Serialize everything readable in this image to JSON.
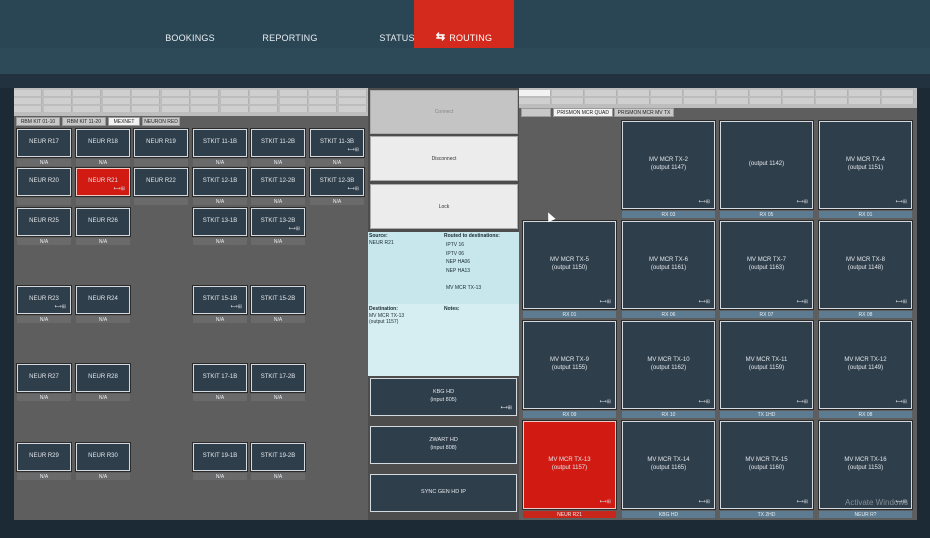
{
  "nav": {
    "bookings": "BOOKINGS",
    "reporting": "REPORTING",
    "status": "STATUS",
    "routing": "ROUTING"
  },
  "left": {
    "tabs": [
      "RBM KIT 01-10",
      "RBM KIT 11-20",
      "MEXNET",
      "NEURON RED"
    ],
    "tiles": [
      {
        "name": "NEUR R17",
        "label": "N/A"
      },
      {
        "name": "NEUR R18",
        "label": "N/A"
      },
      {
        "name": "NEUR R19",
        "label": ""
      },
      {
        "name": "STKIT 11-1B",
        "label": "N/A"
      },
      {
        "name": "STKIT 11-2B",
        "label": "N/A"
      },
      {
        "name": "STKIT 11-3B",
        "label": "N/A"
      },
      {
        "name": "NEUR R20",
        "label": ""
      },
      {
        "name": "NEUR R21",
        "label": ""
      },
      {
        "name": "NEUR R22",
        "label": ""
      },
      {
        "name": "STKIT 12-1B",
        "label": "N/A"
      },
      {
        "name": "STKIT 12-2B",
        "label": "N/A"
      },
      {
        "name": "STKIT 12-3B",
        "label": "N/A"
      },
      {
        "name": "NEUR R25",
        "label": "N/A"
      },
      {
        "name": "NEUR R26",
        "label": "N/A"
      },
      {
        "name": "STKIT 13-1B",
        "label": "N/A"
      },
      {
        "name": "STKIT 13-2B",
        "label": "N/A"
      },
      {
        "name": "NEUR R23",
        "label": "N/A"
      },
      {
        "name": "NEUR R24",
        "label": "N/A"
      },
      {
        "name": "STKIT 15-1B",
        "label": "N/A"
      },
      {
        "name": "STKIT 15-2B",
        "label": "N/A"
      },
      {
        "name": "NEUR R27",
        "label": "N/A"
      },
      {
        "name": "NEUR R28",
        "label": "N/A"
      },
      {
        "name": "STKIT 17-1B",
        "label": "N/A"
      },
      {
        "name": "STKIT 17-2B",
        "label": "N/A"
      },
      {
        "name": "NEUR R29",
        "label": "N/A"
      },
      {
        "name": "NEUR R30",
        "label": "N/A"
      },
      {
        "name": "STKIT 19-1B",
        "label": "N/A"
      },
      {
        "name": "STKIT 19-2B",
        "label": "N/A"
      }
    ]
  },
  "middle": {
    "connect": "Connect",
    "disconnect": "Disconnect",
    "lock": "Lock",
    "source_header": "Source:",
    "source_value": "NEUR R21",
    "routed_header": "Routed to destinations:",
    "routed": [
      "IPTV 16",
      "IPTV 06",
      "NEP HA06",
      "NEP HA13",
      "",
      "MV MCR TX-13"
    ],
    "destination_header": "Destination:",
    "destination_value": "MV MCR TX-13",
    "destination_output": "(output 1157)",
    "notes_header": "Notes:",
    "sources": [
      {
        "name": "KBG HD",
        "sub": "(input 805)"
      },
      {
        "name": "ZWART HD",
        "sub": "(input 808)"
      },
      {
        "name": "SYNC GEN HD IP",
        "sub": ""
      }
    ]
  },
  "right": {
    "tabs": [
      "PRISMON MCR QUAD",
      "PRISMON MCR MV TX"
    ],
    "tiles": [
      {
        "name": "",
        "sub": "",
        "label": ""
      },
      {
        "name": "MV MCR TX-2",
        "sub": "(output 1147)",
        "label": "RX 03"
      },
      {
        "name": "",
        "sub": "(output 1142)",
        "label": "RX 05"
      },
      {
        "name": "MV MCR TX-4",
        "sub": "(output 1151)",
        "label": "RX 01"
      },
      {
        "name": "MV MCR TX-5",
        "sub": "(output 1150)",
        "label": "RX 01"
      },
      {
        "name": "MV MCR TX-6",
        "sub": "(output 1161)",
        "label": "RX 06"
      },
      {
        "name": "MV MCR TX-7",
        "sub": "(output 1163)",
        "label": "RX 07"
      },
      {
        "name": "MV MCR TX-8",
        "sub": "(output 1148)",
        "label": "RX 08"
      },
      {
        "name": "MV MCR TX-9",
        "sub": "(output 1155)",
        "label": "RX 09"
      },
      {
        "name": "MV MCR TX-10",
        "sub": "(output 1162)",
        "label": "RX 10"
      },
      {
        "name": "MV MCR TX-11",
        "sub": "(output 1159)",
        "label": "TX 1HD"
      },
      {
        "name": "MV MCR TX-12",
        "sub": "(output 1149)",
        "label": "RX 08"
      },
      {
        "name": "MV MCR TX-13",
        "sub": "(output 1157)",
        "label": "NEUR R21"
      },
      {
        "name": "MV MCR TX-14",
        "sub": "(output 1165)",
        "label": "KBG HD"
      },
      {
        "name": "MV MCR TX-15",
        "sub": "(output 1160)",
        "label": "TX 2HD"
      },
      {
        "name": "MV MCR TX-16",
        "sub": "(output 1153)",
        "label": "NEUR R?"
      }
    ]
  },
  "watermark": "Activate Windows",
  "colors": {
    "accent": "#d42a1d",
    "tile": "#2f3e4b",
    "label": "#5d7c92",
    "info": "#c7e7ed"
  }
}
